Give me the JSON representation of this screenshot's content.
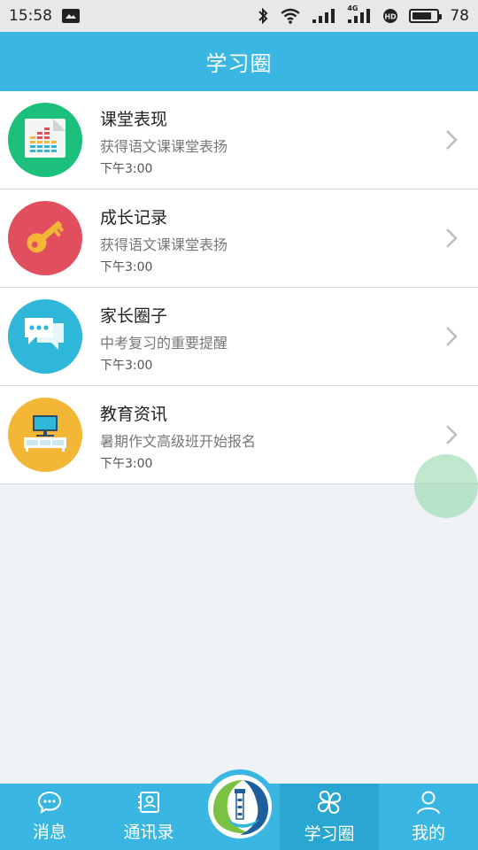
{
  "status_bar": {
    "time": "15:58",
    "battery_level": "78",
    "network_label": "4G"
  },
  "header": {
    "title": "学习圈"
  },
  "feed": [
    {
      "title": "课堂表现",
      "subtitle": "获得语文课课堂表扬",
      "time": "下午3:00",
      "icon": "equalizer-chart-icon",
      "color": "#1cbf7c"
    },
    {
      "title": "成长记录",
      "subtitle": "获得语文课课堂表扬",
      "time": "下午3:00",
      "icon": "key-icon",
      "color": "#e14f5f"
    },
    {
      "title": "家长圈子",
      "subtitle": "中考复习的重要提醒",
      "time": "下午3:00",
      "icon": "chat-bubbles-icon",
      "color": "#2fb7d9"
    },
    {
      "title": "教育资讯",
      "subtitle": "暑期作文高级班开始报名",
      "time": "下午3:00",
      "icon": "tv-cabinet-icon",
      "color": "#f3b637"
    }
  ],
  "tabs": [
    {
      "label": "消息",
      "icon": "chat-icon"
    },
    {
      "label": "通讯录",
      "icon": "contacts-icon"
    },
    {
      "label": "学习圈",
      "icon": "clover-icon",
      "active": true
    },
    {
      "label": "我的",
      "icon": "person-icon"
    }
  ],
  "center_button": {
    "icon": "lighthouse-logo-icon"
  }
}
